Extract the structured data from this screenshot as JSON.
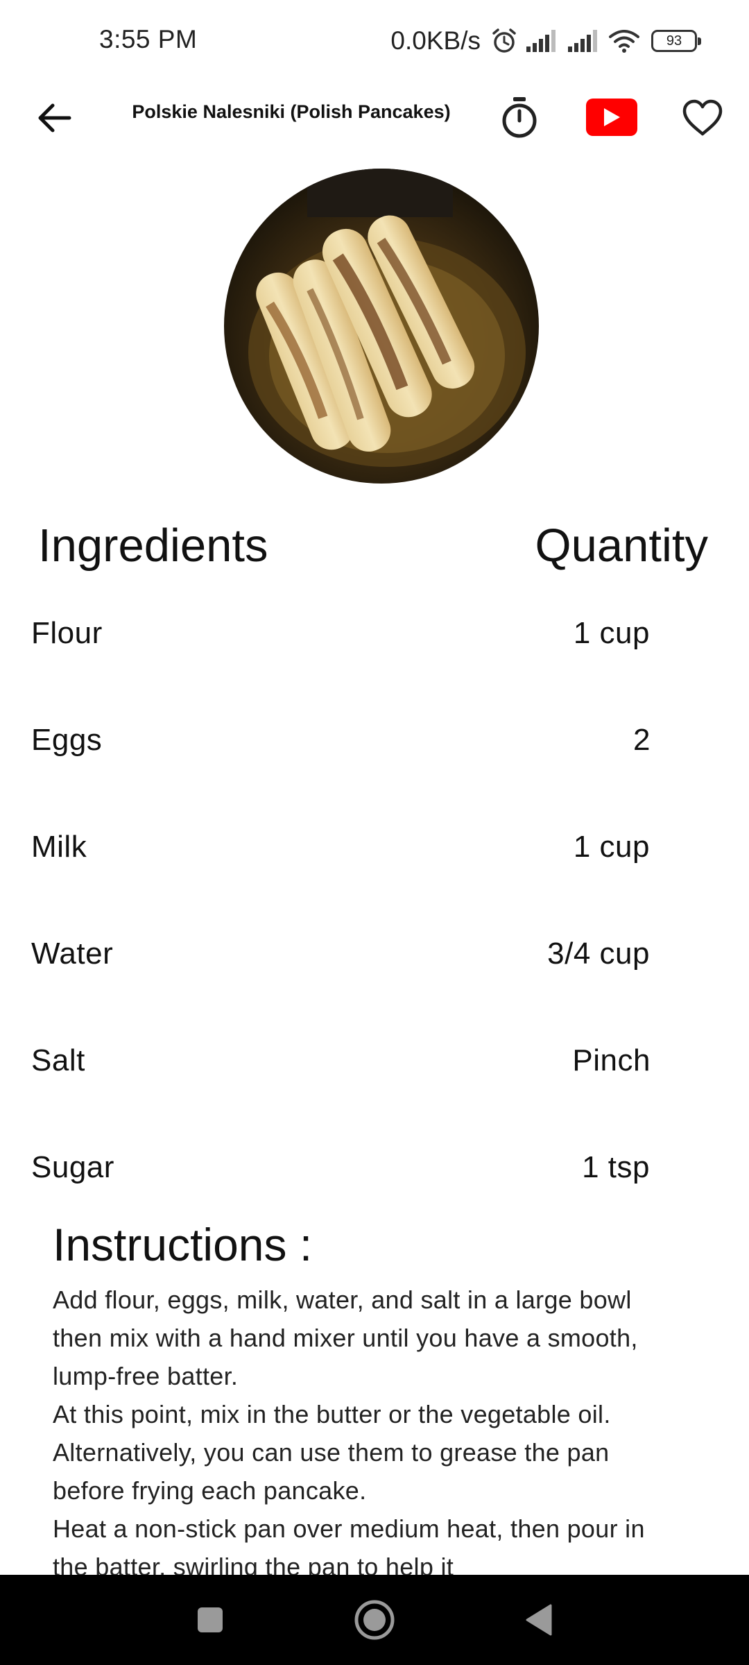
{
  "status_bar": {
    "time": "3:55 PM",
    "net_speed": "0.0KB/s",
    "battery_level": "93"
  },
  "app_bar": {
    "title": "Polskie Nalesniki (Polish Pancakes)"
  },
  "ingredients": {
    "header_name": "Ingredients",
    "header_quantity": "Quantity",
    "items": [
      {
        "name": "Flour",
        "quantity": "1 cup"
      },
      {
        "name": "Eggs",
        "quantity": "2"
      },
      {
        "name": "Milk",
        "quantity": "1 cup"
      },
      {
        "name": "Water",
        "quantity": "3/4 cup"
      },
      {
        "name": "Salt",
        "quantity": "Pinch"
      },
      {
        "name": "Sugar",
        "quantity": "1 tsp"
      }
    ]
  },
  "instructions": {
    "title": "Instructions :",
    "paragraphs": [
      "Add flour, eggs, milk, water, and salt in a large bowl then mix with a hand mixer until you have a smooth, lump-free batter.",
      "At this point, mix in the butter or the vegetable oil. Alternatively, you can use them to grease the pan before frying each pancake.",
      "Heat a non-stick pan over medium heat, then pour in the batter, swirling the pan to help it"
    ]
  },
  "colors": {
    "youtube_red": "#ff0000",
    "nav_bar": "#000000",
    "text": "#111111"
  },
  "icons": {
    "back": "arrow-left-icon",
    "timer": "stopwatch-icon",
    "youtube": "youtube-play-icon",
    "favorite": "heart-outline-icon",
    "nav_recents": "square-icon",
    "nav_home": "circle-icon",
    "nav_back": "triangle-back-icon"
  }
}
